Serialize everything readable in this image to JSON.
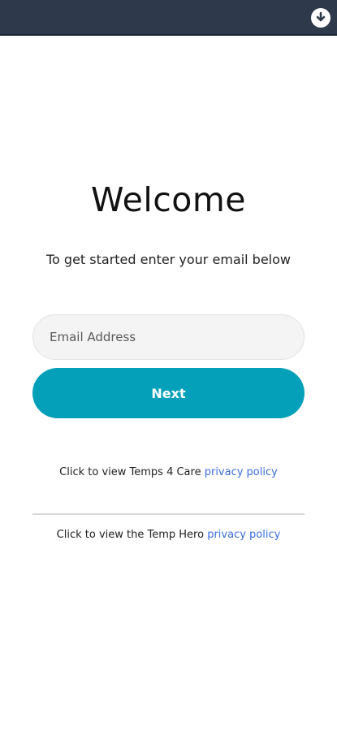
{
  "statusbar": {
    "icon": "download-circle-icon",
    "background": "#2e3a4b"
  },
  "welcome": {
    "title": "Welcome",
    "subtitle": "To get started enter your email below"
  },
  "form": {
    "email_placeholder": "Email Address",
    "email_value": "",
    "next_label": "Next",
    "accent_color": "#04a0b9"
  },
  "policies": [
    {
      "prefix": "Click to view Temps 4 Care",
      "link": "privacy policy"
    },
    {
      "prefix": "Click to view the Temp Hero",
      "link": "privacy policy"
    }
  ],
  "link_color": "#3b6fe0"
}
